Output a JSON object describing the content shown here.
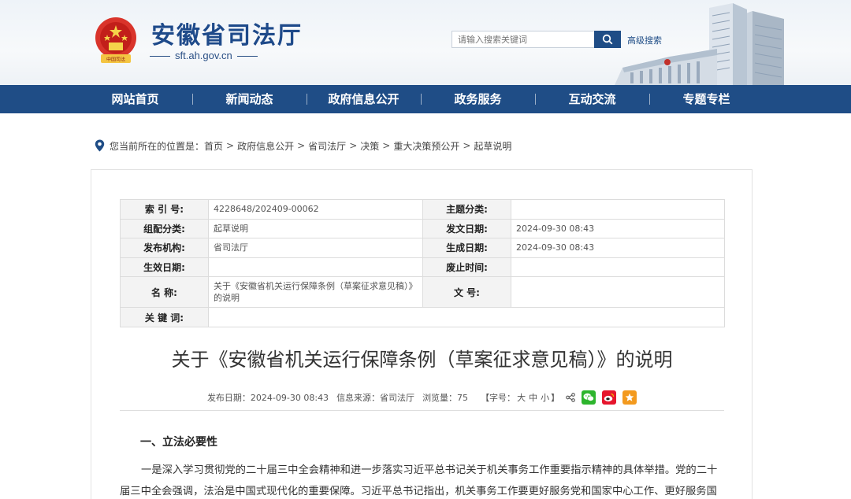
{
  "header": {
    "site_title": "安徽省司法厅",
    "site_domain": "sft.ah.gov.cn",
    "emblem_caption": "中国司法",
    "search_placeholder": "请输入搜索关键词",
    "advanced_search": "高级搜索"
  },
  "nav": {
    "items": [
      {
        "label": "网站首页"
      },
      {
        "label": "新闻动态"
      },
      {
        "label": "政府信息公开"
      },
      {
        "label": "政务服务"
      },
      {
        "label": "互动交流"
      },
      {
        "label": "专题专栏"
      }
    ]
  },
  "breadcrumb": {
    "prefix": "您当前所在的位置是：",
    "items": [
      "首页",
      "政府信息公开",
      "省司法厅",
      "决策",
      "重大决策预公开",
      "起草说明"
    ],
    "sep": ">"
  },
  "meta": {
    "index_label": "索 引 号:",
    "index_value": "4228648/202409-00062",
    "topic_label": "主题分类:",
    "topic_value": "",
    "category_label": "组配分类:",
    "category_value": "起草说明",
    "pub_date_label": "发文日期:",
    "pub_date_value": "2024-09-30 08:43",
    "org_label": "发布机构:",
    "org_value": "省司法厅",
    "gen_date_label": "生成日期:",
    "gen_date_value": "2024-09-30 08:43",
    "effective_label": "生效日期:",
    "effective_value": "",
    "abolish_label": "废止时间:",
    "abolish_value": "",
    "name_label": "名      称:",
    "name_value": "关于《安徽省机关运行保障条例（草案征求意见稿）》的说明",
    "docno_label": "文      号:",
    "docno_value": "",
    "keywords_label": "关 键 词:",
    "keywords_value": ""
  },
  "article": {
    "title": "关于《安徽省机关运行保障条例（草案征求意见稿）》的说明",
    "publish_date": "发布日期：2024-09-30 08:43",
    "source": "信息来源：省司法厅",
    "views": "浏览量：75",
    "font_size_prefix": "【字号：",
    "font_large": "大",
    "font_medium": "中",
    "font_small": "小",
    "font_size_suffix": "】",
    "section1_heading": "一、立法必要性",
    "para1": "一是深入学习贯彻党的二十届三中全会精神和进一步落实习近平总书记关于机关事务工作重要指示精神的具体举措。党的二十届三中全会强调，法治是中国式现代化的重要保障。习近平总书记指出，机关事务工作要更好服务党和国家中心工作、更好服务国家治"
  },
  "colors": {
    "brand_blue": "#1f4d86",
    "wechat_green": "#2db52d",
    "weibo_red": "#e6162d",
    "favorite_orange": "#f39a1e"
  }
}
